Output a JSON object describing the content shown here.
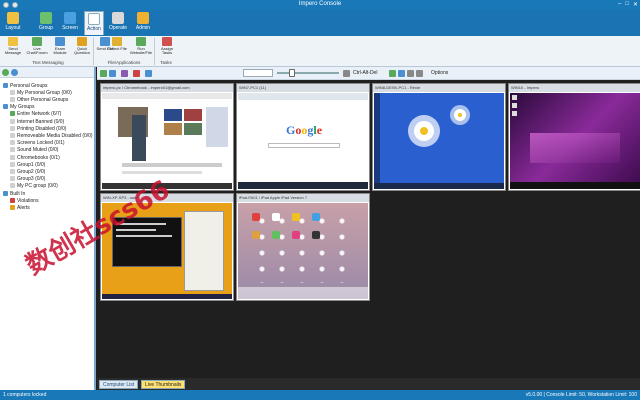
{
  "window": {
    "title": "Impero Console"
  },
  "ribbon_tabs": [
    {
      "label": "Layout"
    },
    {
      "label": "Group"
    },
    {
      "label": "Screen"
    },
    {
      "label": "Action"
    },
    {
      "label": "Operate"
    },
    {
      "label": "Admin"
    }
  ],
  "ribbon_buttons": {
    "send_message": "Send Message",
    "live_chat": "Live Chat/Forum",
    "exam_module": "Exam Module",
    "quick_question": "Quick Question",
    "send_file": "Send File",
    "collect_file": "Collect File",
    "run_website": "Run Website/File",
    "assign_tasks": "Assign Tasks"
  },
  "ribbon_groups": {
    "text_messaging": "Text Messaging",
    "file_applications": "File/Applications",
    "tasks": "Tasks"
  },
  "toolbar": {
    "shortcut": "Ctrl-Alt-Del",
    "options": "Options"
  },
  "tree": [
    {
      "label": "Personal Groups"
    },
    {
      "label": "My Personal Group (0/0)"
    },
    {
      "label": "Other Personal Groups"
    },
    {
      "label": "My Groups"
    },
    {
      "label": "Entire Network (6/7)"
    },
    {
      "label": "Internet Banned (0/0)"
    },
    {
      "label": "Printing Disabled (0/0)"
    },
    {
      "label": "Removeable Media Disabled (0/0)"
    },
    {
      "label": "Screens Locked (0/1)"
    },
    {
      "label": "Sound Muted (0/0)"
    },
    {
      "label": "Chromebooks (0/1)"
    },
    {
      "label": "Group1 (0/0)"
    },
    {
      "label": "Group2 (0/0)"
    },
    {
      "label": "Group3 (0/0)"
    },
    {
      "label": "My PC group (0/0)"
    },
    {
      "label": "Built In"
    },
    {
      "label": "Violations"
    },
    {
      "label": "Alerts"
    }
  ],
  "thumbnails": [
    {
      "caption": "impero-pc \\ Chromebook - impero01@gmail.com"
    },
    {
      "caption": "WIN7-PC1 (11)"
    },
    {
      "caption": "WIN8-DESK-PC1 - Rexie"
    },
    {
      "caption": "WIN10 - Impero"
    },
    {
      "caption": "WIN-XP-SP3 - user"
    },
    {
      "caption": "iPad-FA01 / iPad Apple iPad Version 7"
    }
  ],
  "bottom_tabs": {
    "computer_list": "Computer List",
    "live_thumbnails": "Live Thumbnails"
  },
  "status": {
    "left": "1 computers locked",
    "right": "v5.0.00 | Console Limit: 50, Workstation Limit: 100"
  },
  "watermark": "数创社scs66",
  "colors": {
    "accent": "#1878b8",
    "background": "#1f1f1f"
  }
}
